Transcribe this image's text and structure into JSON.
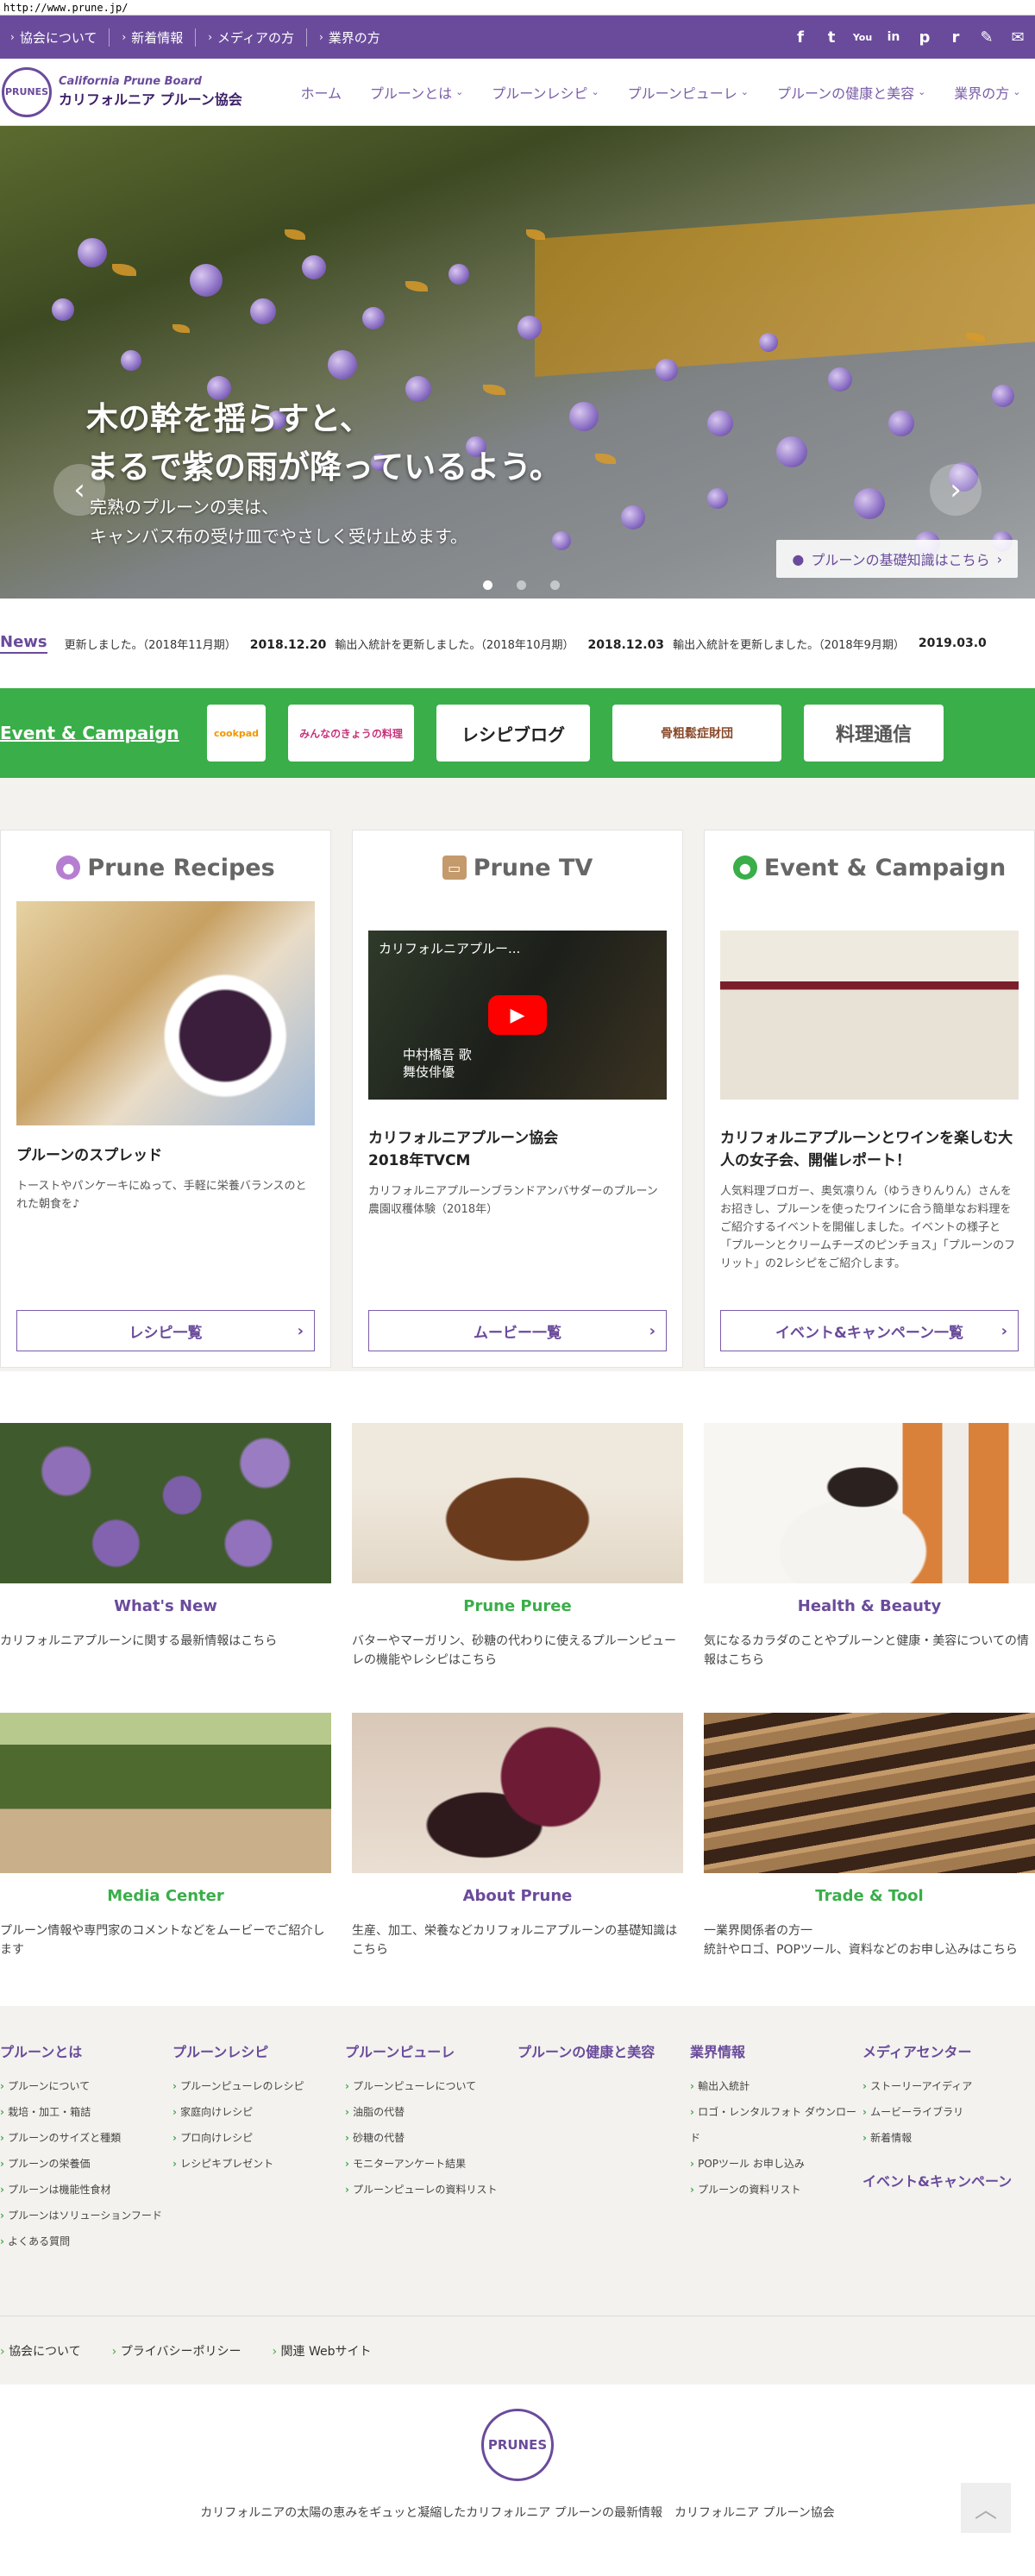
{
  "address": "http://www.prune.jp/",
  "topbar": {
    "links": [
      "協会について",
      "新着情報",
      "メディアの方",
      "業界の方"
    ],
    "social": [
      "f",
      "t",
      "You",
      "in",
      "p",
      "r",
      "✎",
      "✉"
    ]
  },
  "logo": {
    "en": "California Prune Board",
    "jp": "カリフォルニア プルーン協会",
    "badge": "PRUNES"
  },
  "nav": [
    "ホーム",
    "プルーンとは",
    "プルーンレシピ",
    "プルーンピューレ",
    "プルーンの健康と美容",
    "業界の方"
  ],
  "hero": {
    "headline1": "木の幹を揺らすと、",
    "headline2": "まるで紫の雨が降っているよう。",
    "sub1": "完熟のプルーンの実は、",
    "sub2": "キャンバス布の受け皿でやさしく受け止めます。",
    "cta": "プルーンの基礎知識はこちら"
  },
  "news": {
    "label": "News",
    "items": [
      {
        "date": "",
        "text": "更新しました。（2018年11月期）"
      },
      {
        "date": "2018.12.20",
        "text": "輸出入統計を更新しました。（2018年10月期）"
      },
      {
        "date": "2018.12.03",
        "text": "輸出入統計を更新しました。（2018年9月期）"
      },
      {
        "date": "2019.03.0",
        "text": ""
      }
    ]
  },
  "event": {
    "title": "Event & Campaign",
    "sponsors": [
      "cookpad",
      "みんなのきょうの料理",
      "レシピブログ",
      "骨粗鬆症財団",
      "料理通信"
    ]
  },
  "cards": [
    {
      "title": "Prune Recipes",
      "heading": "プルーンのスプレッド",
      "desc": "トーストやパンケーキにぬって、手軽に栄養バランスのとれた朝食を♪",
      "button": "レシピ一覧"
    },
    {
      "title": "Prune TV",
      "heading": "カリフォルニアプルーン協会\n2018年TVCM",
      "desc": "カリフォルニアプルーンブランドアンバサダーのプルーン農園収穫体験（2018年）",
      "button": "ムービー一覧",
      "video_title": "カリフォルニアプルー...",
      "video_caption": "中村橋吾 歌舞伎俳優"
    },
    {
      "title": "Event & Campaign",
      "heading": "カリフォルニアプルーンとワインを楽しむ大人の女子会、開催レポート！",
      "desc": "人気料理ブロガー、奥気凛りん（ゆうきりんりん）さんをお招きし、プルーンを使ったワインに合う簡単なお料理をご紹介するイベントを開催しました。イベントの様子と「プルーンとクリームチーズのピンチョス」「プルーンのフリット」の2レシピをご紹介します。",
      "button": "イベント&キャンペーン一覧"
    }
  ],
  "tiles": [
    {
      "title": "What's New",
      "desc": "カリフォルニアプルーンに関する最新情報はこちら"
    },
    {
      "title": "Prune Puree",
      "desc": "バターやマーガリン、砂糖の代わりに使えるプルーンピューレの機能やレシピはこちら"
    },
    {
      "title": "Health & Beauty",
      "desc": "気になるカラダのことやプルーンと健康・美容についての情報はこちら"
    },
    {
      "title": "Media Center",
      "desc": "プルーン情報や専門家のコメントなどをムービーでご紹介します"
    },
    {
      "title": "About Prune",
      "desc": "生産、加工、栄養などカリフォルニアプルーンの基礎知識はこちら"
    },
    {
      "title": "Trade & Tool",
      "desc": "一業界関係者の方一\n統計やロゴ、POPツール、資料などのお申し込みはこちら"
    }
  ],
  "footer": {
    "cols": [
      {
        "title": "プルーンとは",
        "items": [
          "プルーンについて",
          "栽培・加工・箱詰",
          "プルーンのサイズと種類",
          "プルーンの栄養価",
          "プルーンは機能性食材",
          "プルーンはソリューションフード",
          "よくある質問"
        ]
      },
      {
        "title": "プルーンレシピ",
        "items": [
          "プルーンピューレのレシピ",
          "家庭向けレシピ",
          "プロ向けレシピ",
          "レシピキプレゼント"
        ]
      },
      {
        "title": "プルーンピューレ",
        "items": [
          "プルーンピューレについて",
          "油脂の代替",
          "砂糖の代替",
          "モニターアンケート結果",
          "プルーンピューレの資料リスト"
        ]
      },
      {
        "title": "プルーンの健康と美容",
        "items": []
      },
      {
        "title": "業界情報",
        "items": [
          "輸出入統計",
          "ロゴ・レンタルフォト ダウンロード",
          "POPツール お申し込み",
          "プルーンの資料リスト"
        ]
      },
      {
        "title": "メディアセンター",
        "items": [
          "ストーリーアイディア",
          "ムービーライブラリ",
          "新着情報"
        ],
        "extra": "イベント&キャンペーン"
      }
    ],
    "sub": [
      "協会について",
      "プライバシーポリシー",
      "関連 Webサイト"
    ],
    "copyright": "カリフォルニアの太陽の恵みをギュッと凝縮したカリフォルニア プルーンの最新情報　カリフォルニア プルーン協会",
    "logo": "PRUNES",
    "totop": "︿"
  },
  "colors": {
    "brand": "#6a4b9b",
    "green": "#3aae49",
    "bg": "#f3f2ee"
  }
}
